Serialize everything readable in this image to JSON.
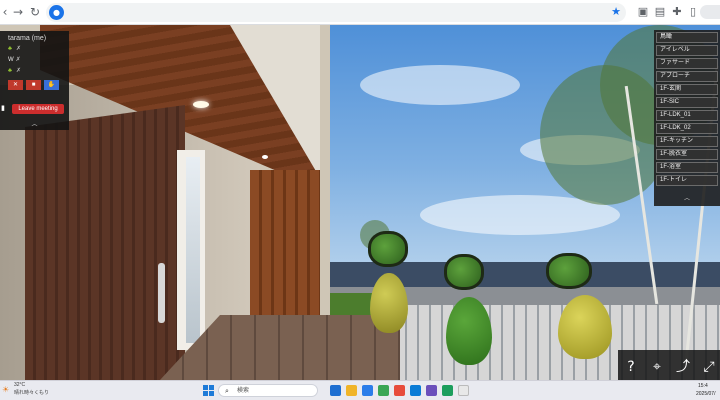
{
  "browser": {
    "back_icon": "arrow-left-icon",
    "forward_icon": "arrow-right-icon",
    "reload_icon": "reload-icon",
    "toolbar_icons": [
      "bookmark-star-icon",
      "extension-icon",
      "screenshot-icon",
      "puzzle-icon",
      "sidebar-icon",
      "profile-avatar"
    ]
  },
  "meeting": {
    "participant_name": "tarama (me)",
    "rows": [
      {
        "prefix": "",
        "label": ""
      },
      {
        "prefix": "",
        "label": "W"
      },
      {
        "prefix": "",
        "label": ""
      }
    ],
    "buttons": [
      "mic-off-icon",
      "camera-off-icon",
      "hand-raise-icon"
    ],
    "leave_label": "Leave meeting",
    "collapse_glyph": "︿"
  },
  "views": {
    "items": [
      "鳥瞰",
      "アイレベル",
      "ファサード",
      "アプローチ",
      "1F-玄関",
      "1F-SIC",
      "1F-LDK_01",
      "1F-LDK_02",
      "1F-キッチン",
      "1F-脱衣室",
      "1F-浴室",
      "1F-トイレ"
    ],
    "collapse_glyph": "︿"
  },
  "controls": {
    "help": "?",
    "items": [
      "help-icon",
      "location-pin-icon",
      "route-icon",
      "fullscreen-icon"
    ]
  },
  "taskbar": {
    "weather_temp": "32°C",
    "weather_desc": "晴れ時々くもり",
    "search_placeholder": "検索",
    "clock_time": "15:4",
    "clock_date": "2025/07/",
    "app_colors": [
      "#1f6fd1",
      "#f0b429",
      "#2b7de9",
      "#3aa655",
      "#e74c3c",
      "#0a7bd6",
      "#6b4fbb",
      "#1c9e5d",
      "#e8e8e8"
    ]
  },
  "colors": {
    "leave_button": "#cc2d2d",
    "mic_off": "#c0392b",
    "camera_off": "#c0392b",
    "hand": "#3a6fd8",
    "avatar_body_1": "#b7b43a",
    "avatar_body_2": "#3f8a2b",
    "avatar_body_3": "#c9c13b"
  }
}
